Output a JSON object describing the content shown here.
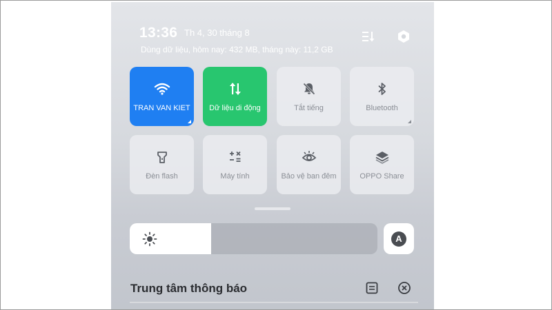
{
  "header": {
    "time": "13:36",
    "date": "Th 4, 30 tháng 8",
    "data_usage": "Dùng dữ liệu, hôm nay: 432 MB, tháng này: 11,2 GB",
    "icons": [
      "edit-tiles-icon",
      "settings-icon"
    ]
  },
  "tiles": [
    {
      "label": "TRAN VAN KIET",
      "icon": "wifi-icon",
      "state": "on",
      "color": "#1f7ff2"
    },
    {
      "label": "Dữ liệu di động",
      "icon": "mobile-data-icon",
      "state": "on",
      "color": "#28c66f"
    },
    {
      "label": "Tắt tiếng",
      "icon": "mute-bell-icon",
      "state": "off"
    },
    {
      "label": "Bluetooth",
      "icon": "bluetooth-icon",
      "state": "off"
    },
    {
      "label": "Đèn flash",
      "icon": "flashlight-icon",
      "state": "off"
    },
    {
      "label": "Máy tính",
      "icon": "calculator-icon",
      "state": "off"
    },
    {
      "label": "Bảo vệ ban đêm",
      "icon": "eye-icon",
      "state": "off"
    },
    {
      "label": "OPPO Share",
      "icon": "oppo-share-icon",
      "state": "off"
    }
  ],
  "brightness": {
    "level_percent": 33,
    "auto_label": "A"
  },
  "notifications": {
    "title": "Trung tâm thông báo"
  },
  "colors": {
    "accent_blue": "#1f7ff2",
    "accent_green": "#28c66f"
  }
}
